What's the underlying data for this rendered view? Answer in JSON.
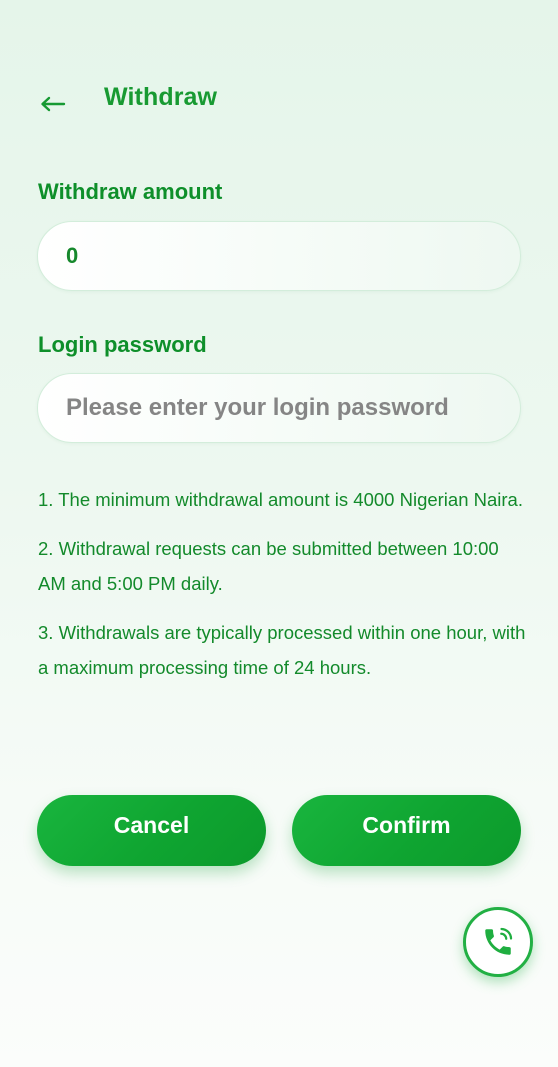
{
  "header": {
    "title": "Withdraw",
    "back_icon": "arrow-left-icon"
  },
  "form": {
    "amount_label": "Withdraw amount",
    "amount_value": "0",
    "password_label": "Login password",
    "password_placeholder": "Please enter your login password",
    "password_value": ""
  },
  "rules": [
    "1. The minimum withdrawal amount is 4000 Nigerian Naira.",
    "2. Withdrawal requests can be submitted between 10:00 AM and 5:00 PM daily.",
    "3. Withdrawals are typically processed within one hour, with a maximum processing time of 24 hours."
  ],
  "buttons": {
    "cancel_label": "Cancel",
    "confirm_label": "Confirm"
  },
  "support": {
    "icon": "phone-icon"
  },
  "colors": {
    "primary": "#11a833",
    "text_green": "#138a2b",
    "placeholder": "#858585"
  }
}
